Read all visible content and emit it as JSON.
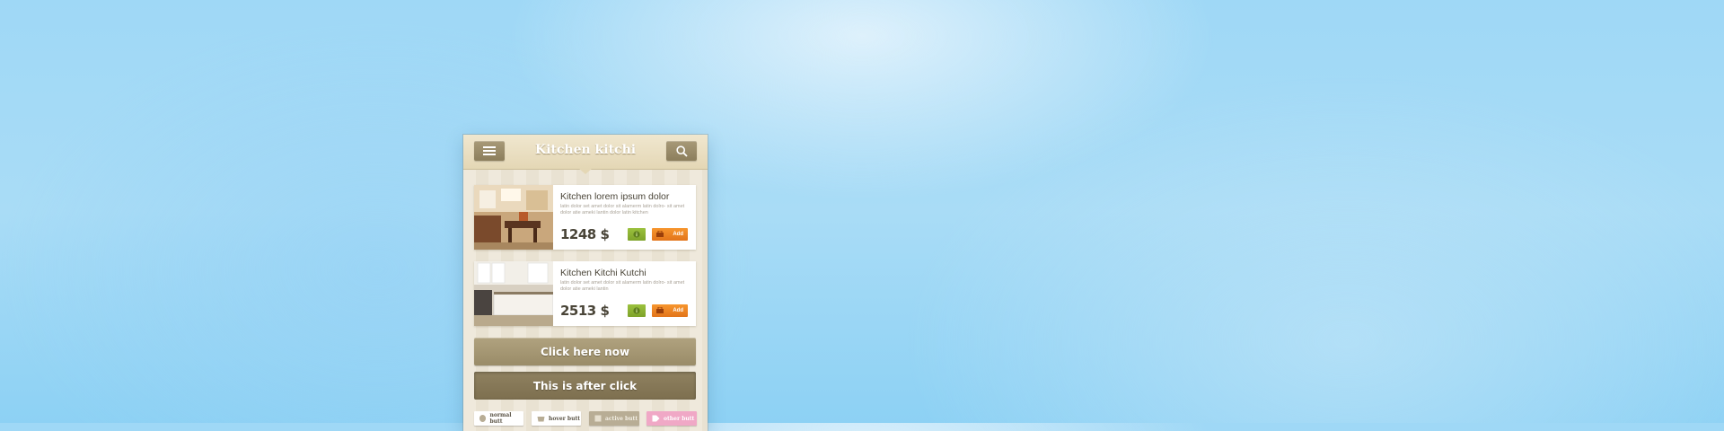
{
  "app": {
    "title": "Kitchen kitchi"
  },
  "header": {
    "menu_icon": "hamburger-icon",
    "search_icon": "search-icon"
  },
  "products": [
    {
      "title": "Kitchen lorem ipsum dolor",
      "description": "latin dolor set amet dolor sit alamerm latin dolro- sit amet dolor atie ameki lantin dolor latin kitchen",
      "price": "1248 $",
      "add_label": "Add"
    },
    {
      "title": "Kitchen Kitchi Kutchi",
      "description": "latin dolor set amet dolor sit alamerm latin dolro- sit amet dolor atie ameki lantin",
      "price": "2513 $",
      "add_label": "Add"
    }
  ],
  "buttons": {
    "primary": "Click here now",
    "after_click": "This is after click"
  },
  "states": [
    {
      "label": "normal butt"
    },
    {
      "label": "hover butt"
    },
    {
      "label": "active butt"
    },
    {
      "label": "other butt"
    }
  ],
  "colors": {
    "accent_green": "#8cb234",
    "accent_orange": "#f08625",
    "header_tan": "#e4d7b5",
    "button_tan": "#a89a75",
    "button_dark_tan": "#867858",
    "pink": "#f0a8c6"
  }
}
